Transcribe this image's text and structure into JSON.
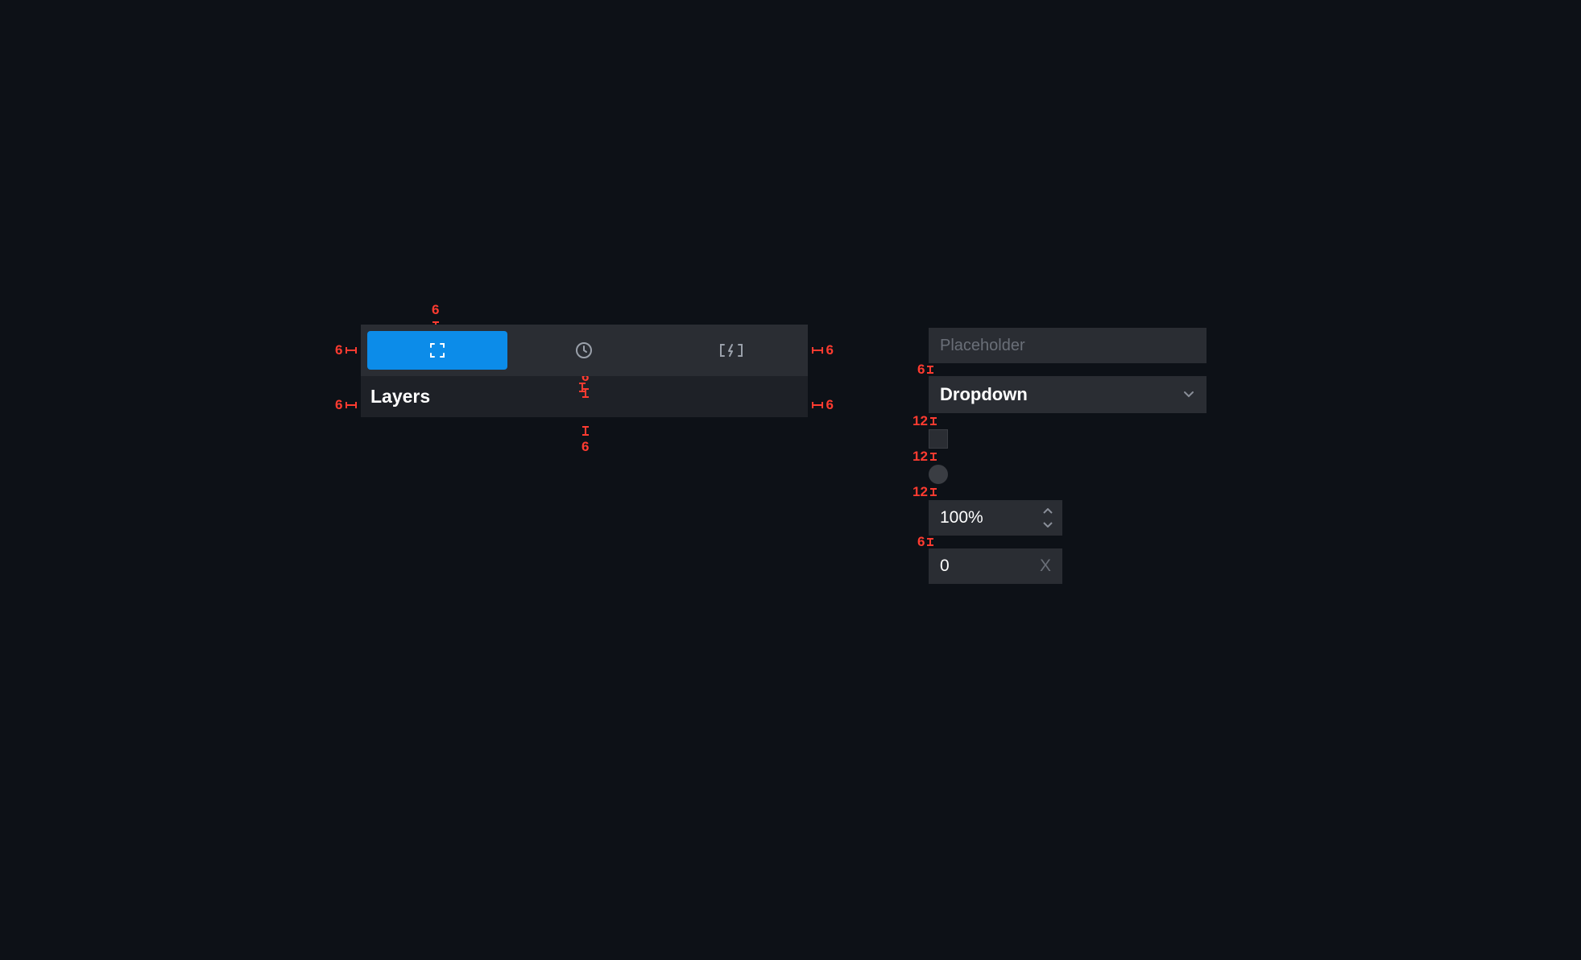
{
  "left_panel": {
    "tabs": [
      {
        "icon": "fullscreen-icon",
        "active": true
      },
      {
        "icon": "clock-icon",
        "active": false
      },
      {
        "icon": "lightning-brackets-icon",
        "active": false
      }
    ],
    "header_label": "Layers",
    "measurements": {
      "tab_top": "6",
      "tab_left": "6",
      "tab_right": "6",
      "tab_bottom": "6",
      "header_left": "6",
      "header_right": "6",
      "header_bottom": "6",
      "header_gap_above": "6"
    }
  },
  "right_panel": {
    "input_placeholder": "Placeholder",
    "gap_input_dropdown": "6",
    "dropdown_label": "Dropdown",
    "gap_dropdown_checkbox": "12",
    "gap_checkbox_radio": "12",
    "gap_radio_stepper": "12",
    "stepper_value": "100%",
    "gap_stepper_numinput": "6",
    "numinput_value": "0",
    "numinput_suffix": "X"
  }
}
